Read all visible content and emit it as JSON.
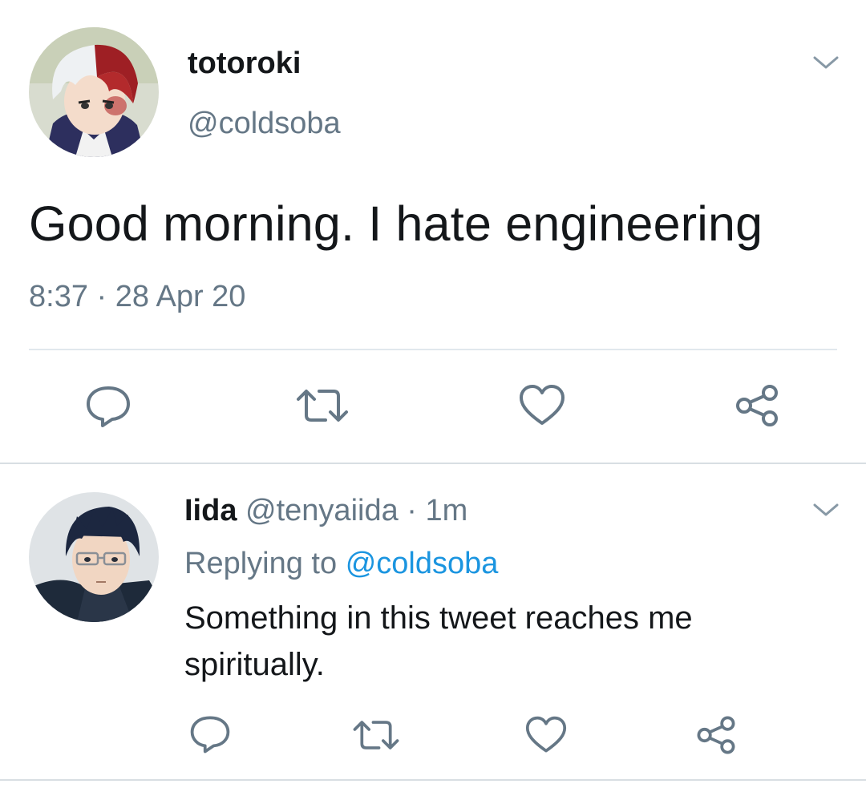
{
  "main_tweet": {
    "display_name": "totoroki",
    "handle": "@coldsoba",
    "text": "Good morning. I hate engineering",
    "time": "8:37",
    "separator": "·",
    "date": "28 Apr 20"
  },
  "reply_tweet": {
    "display_name": "Iida",
    "handle": "@tenyaiida",
    "separator": "·",
    "age": "1m",
    "replying_prefix": "Replying to",
    "replying_handle": "@coldsoba",
    "text": "Something in this tweet reaches me spiritually."
  },
  "icons": {
    "actions": [
      "reply-icon",
      "retweet-icon",
      "like-icon",
      "share-icon"
    ],
    "menu": "chevron-down-icon"
  },
  "colors": {
    "text_primary": "#14171a",
    "text_secondary": "#657786",
    "link": "#1b95e0",
    "icon": "#657786",
    "divider": "#e1e8ed"
  }
}
